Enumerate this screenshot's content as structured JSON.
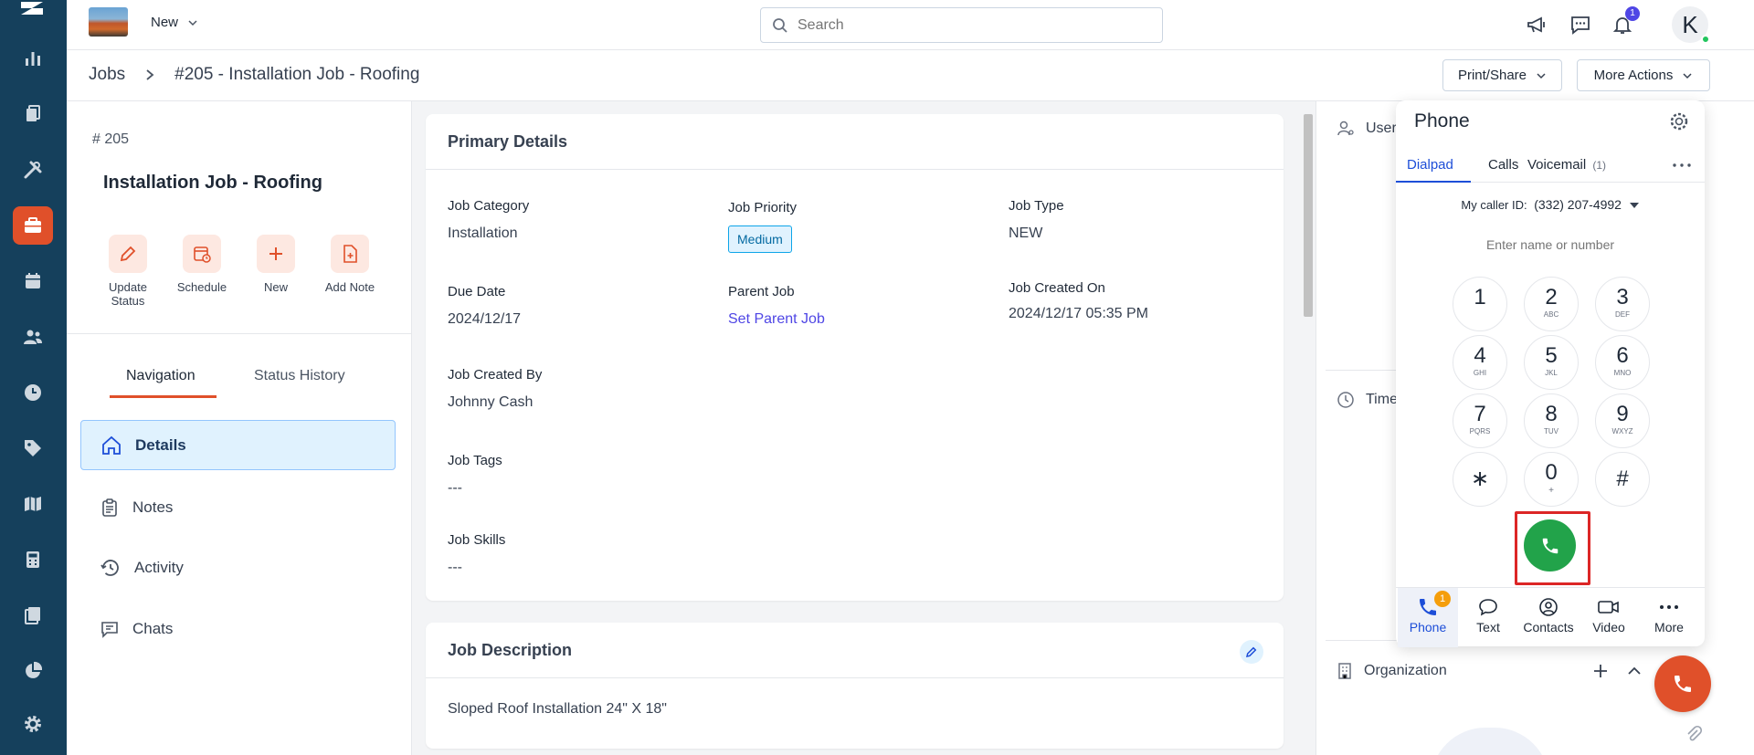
{
  "topbar": {
    "new_label": "New",
    "search_placeholder": "Search",
    "notifications_count": "1",
    "avatar_initial": "K"
  },
  "breadcrumb": {
    "root": "Jobs",
    "current": "#205 - Installation Job - Roofing"
  },
  "header_actions": {
    "print_share": "Print/Share",
    "more_actions": "More Actions"
  },
  "job": {
    "number": "# 205",
    "title": "Installation Job - Roofing"
  },
  "quick_actions": [
    {
      "label": "Update Status",
      "icon": "pencil-icon"
    },
    {
      "label": "Schedule",
      "icon": "calendar-clock-icon"
    },
    {
      "label": "New",
      "icon": "plus-icon"
    },
    {
      "label": "Add Note",
      "icon": "note-add-icon"
    }
  ],
  "left_tabs": {
    "navigation": "Navigation",
    "status_history": "Status History"
  },
  "nav_items": [
    {
      "label": "Details",
      "icon": "home-icon",
      "active": true
    },
    {
      "label": "Notes",
      "icon": "clipboard-icon",
      "active": false
    },
    {
      "label": "Activity",
      "icon": "history-icon",
      "active": false
    },
    {
      "label": "Chats",
      "icon": "chat-icon",
      "active": false
    }
  ],
  "primary_details": {
    "heading": "Primary Details",
    "job_category_label": "Job Category",
    "job_category": "Installation",
    "job_priority_label": "Job Priority",
    "job_priority": "Medium",
    "job_type_label": "Job Type",
    "job_type": "NEW",
    "due_date_label": "Due Date",
    "due_date": "2024/12/17",
    "parent_job_label": "Parent Job",
    "parent_job": "Set Parent Job",
    "created_on_label": "Job Created On",
    "created_on": "2024/12/17 05:35 PM",
    "created_by_label": "Job Created By",
    "created_by": "Johnny Cash",
    "tags_label": "Job Tags",
    "tags": "---",
    "skills_label": "Job Skills",
    "skills": "---"
  },
  "job_description": {
    "heading": "Job Description",
    "text": "Sloped Roof Installation 24\" X 18\""
  },
  "right_panel": {
    "users_label": "Users",
    "timeline_label": "Timel",
    "organization_label": "Organization"
  },
  "phone": {
    "title": "Phone",
    "tabs": {
      "dialpad": "Dialpad",
      "calls": "Calls",
      "voicemail": "Voicemail",
      "voicemail_count": "(1)"
    },
    "caller_id_label": "My caller ID:",
    "caller_id": "(332) 207-4992",
    "input_placeholder": "Enter name or number",
    "keys": [
      {
        "d": "1",
        "l": ""
      },
      {
        "d": "2",
        "l": "ABC"
      },
      {
        "d": "3",
        "l": "DEF"
      },
      {
        "d": "4",
        "l": "GHI"
      },
      {
        "d": "5",
        "l": "JKL"
      },
      {
        "d": "6",
        "l": "MNO"
      },
      {
        "d": "7",
        "l": "PQRS"
      },
      {
        "d": "8",
        "l": "TUV"
      },
      {
        "d": "9",
        "l": "WXYZ"
      },
      {
        "d": "∗",
        "l": ""
      },
      {
        "d": "0",
        "l": "+"
      },
      {
        "d": "#",
        "l": ""
      }
    ],
    "bottom": {
      "phone": "Phone",
      "phone_badge": "1",
      "text": "Text",
      "contacts": "Contacts",
      "video": "Video",
      "more": "More"
    }
  },
  "colors": {
    "rail": "#15405c",
    "accent": "#e0502a",
    "call_green": "#22a34a",
    "link": "#4f46e5"
  }
}
